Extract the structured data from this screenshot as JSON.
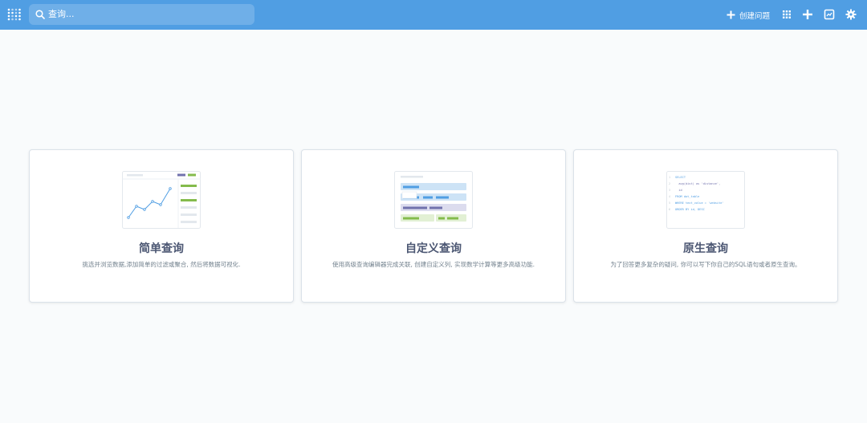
{
  "topbar": {
    "search": {
      "placeholder": "查询..."
    },
    "create_question_label": "创建问题",
    "icons": [
      "grid-icon",
      "plus-icon",
      "dashboard-icon",
      "gear-icon"
    ]
  },
  "cards": [
    {
      "title": "简单查询",
      "description": "挑选并浏览数据,添加简单的过滤或聚合, 然后将数据可视化."
    },
    {
      "title": "自定义查询",
      "description": "使用高级查询编辑器完成关联, 创建自定义列, 实现数学计算等更多高级功能."
    },
    {
      "title": "原生查询",
      "description": "为了回答更多复杂的疑问, 你可以写下你自己的SQL语句或者原生查询。",
      "sql_lines": [
        "SELECT",
        "  avg(dist) as 'distance',",
        "  id",
        "FROM dot_table",
        "WHERE text_value = 'website'",
        "ORDER BY id, DESC"
      ]
    }
  ],
  "colors": {
    "accent": "#509ee3",
    "title": "#4c5773",
    "desc": "#74838f",
    "green": "#84bb4c",
    "purple": "#7172ad"
  }
}
